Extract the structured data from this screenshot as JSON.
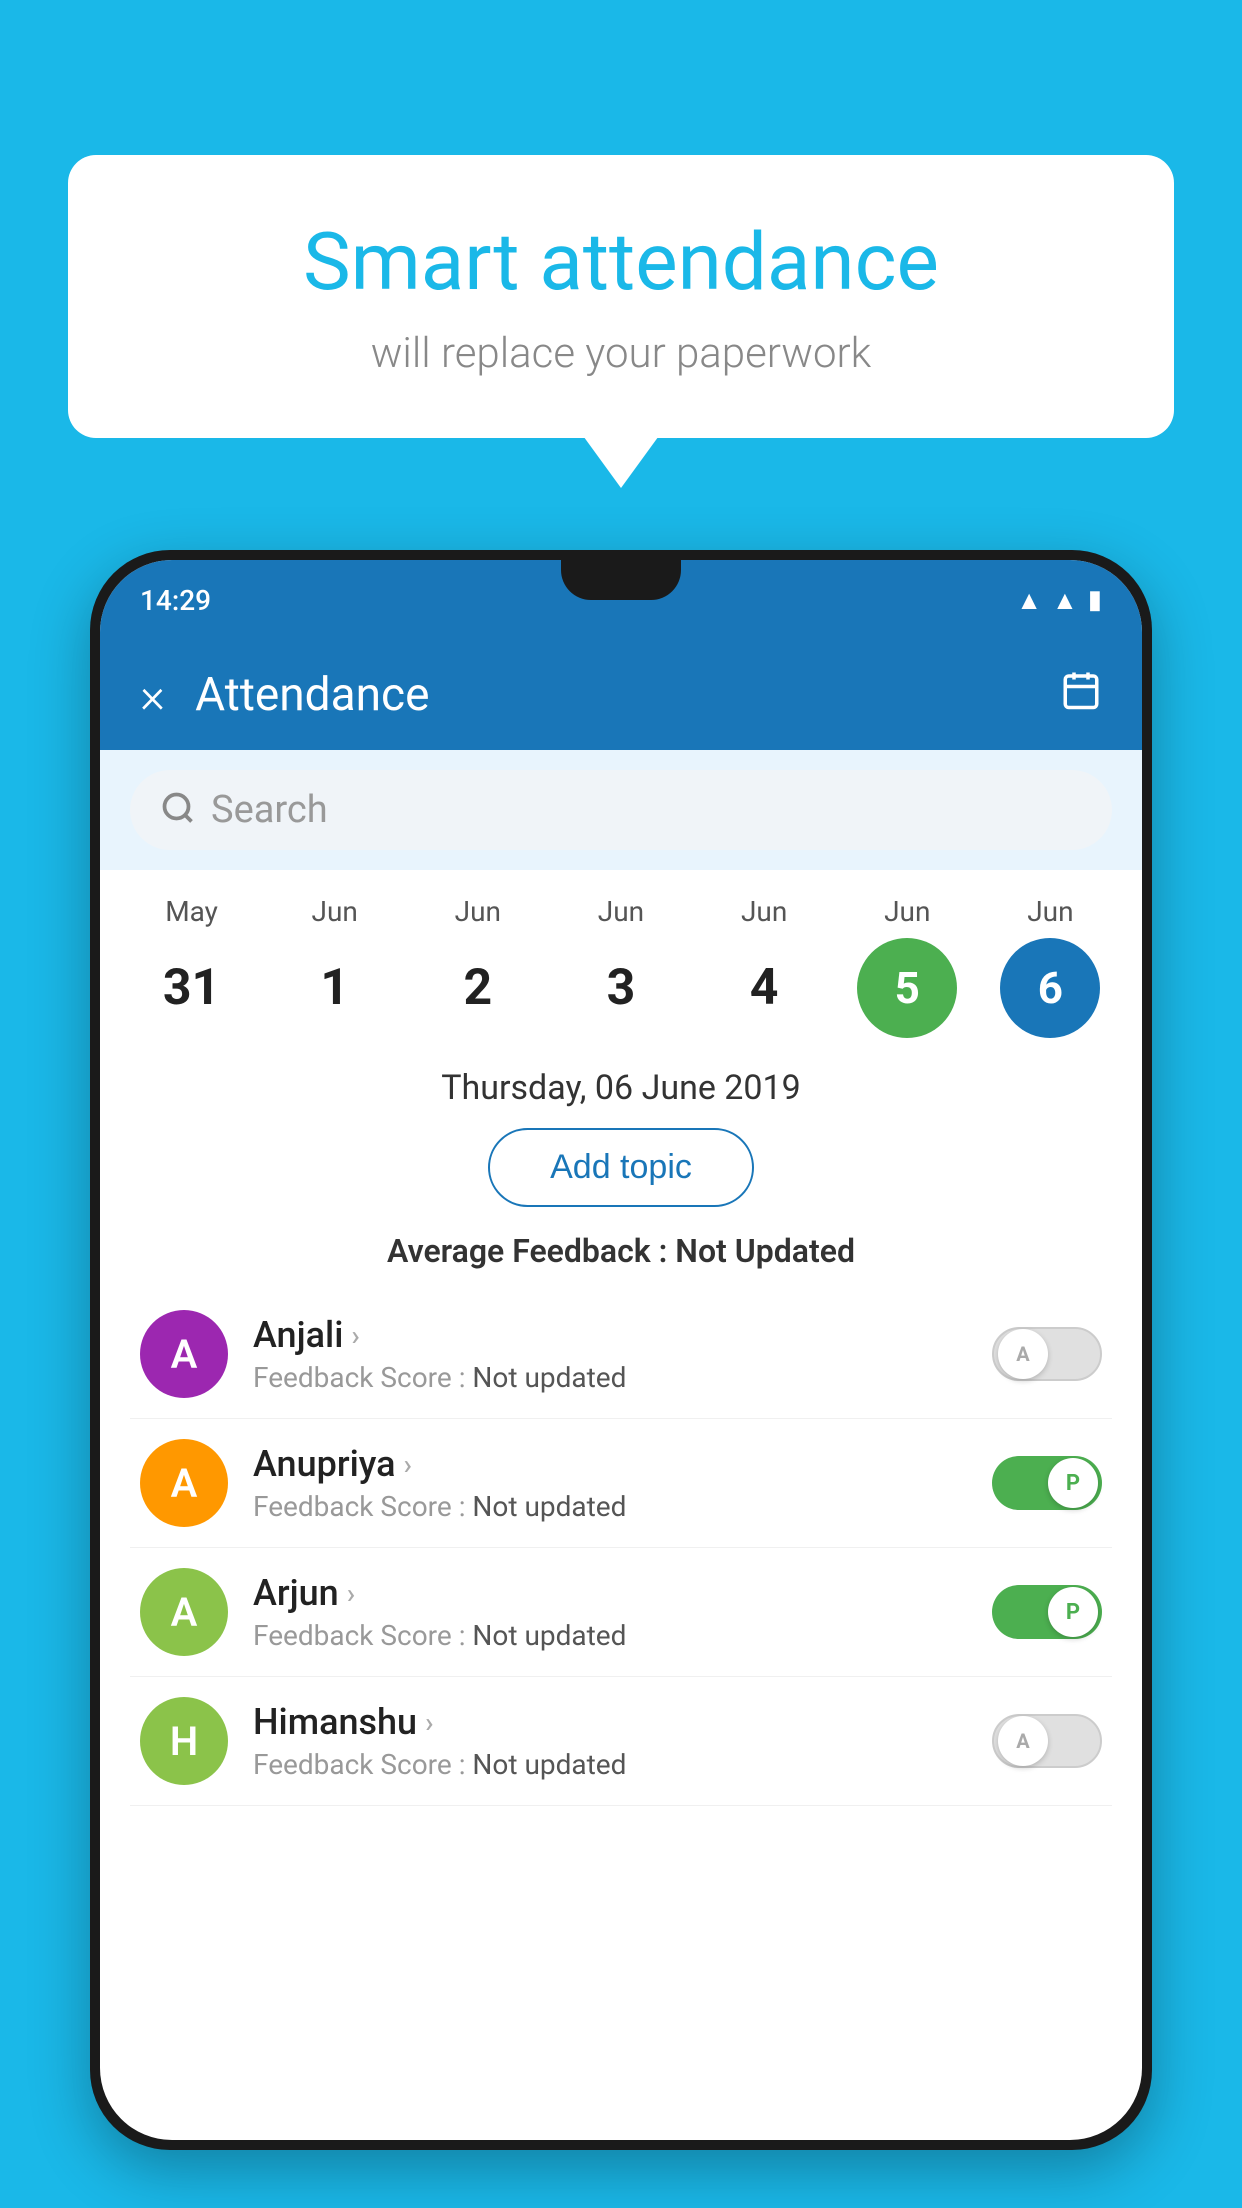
{
  "background_color": "#1ab8e8",
  "speech_bubble": {
    "title": "Smart attendance",
    "subtitle": "will replace your paperwork"
  },
  "status_bar": {
    "time": "14:29",
    "icons": [
      "wifi",
      "signal",
      "battery"
    ]
  },
  "app_bar": {
    "title": "Attendance",
    "close_icon": "×",
    "calendar_icon": "calendar"
  },
  "search": {
    "placeholder": "Search"
  },
  "calendar": {
    "days": [
      {
        "month": "May",
        "date": "31",
        "state": "normal"
      },
      {
        "month": "Jun",
        "date": "1",
        "state": "normal"
      },
      {
        "month": "Jun",
        "date": "2",
        "state": "normal"
      },
      {
        "month": "Jun",
        "date": "3",
        "state": "normal"
      },
      {
        "month": "Jun",
        "date": "4",
        "state": "normal"
      },
      {
        "month": "Jun",
        "date": "5",
        "state": "today"
      },
      {
        "month": "Jun",
        "date": "6",
        "state": "selected"
      }
    ]
  },
  "selected_date": "Thursday, 06 June 2019",
  "add_topic_label": "Add topic",
  "average_feedback_label": "Average Feedback :",
  "average_feedback_value": "Not Updated",
  "students": [
    {
      "name": "Anjali",
      "avatar_letter": "A",
      "avatar_color": "#9c27b0",
      "feedback_label": "Feedback Score :",
      "feedback_value": "Not updated",
      "toggle_state": "off",
      "toggle_label": "A"
    },
    {
      "name": "Anupriya",
      "avatar_letter": "A",
      "avatar_color": "#ff9800",
      "feedback_label": "Feedback Score :",
      "feedback_value": "Not updated",
      "toggle_state": "on",
      "toggle_label": "P"
    },
    {
      "name": "Arjun",
      "avatar_letter": "A",
      "avatar_color": "#8bc34a",
      "feedback_label": "Feedback Score :",
      "feedback_value": "Not updated",
      "toggle_state": "on",
      "toggle_label": "P"
    },
    {
      "name": "Himanshu",
      "avatar_letter": "H",
      "avatar_color": "#8bc34a",
      "feedback_label": "Feedback Score :",
      "feedback_value": "Not updated",
      "toggle_state": "off",
      "toggle_label": "A"
    }
  ]
}
